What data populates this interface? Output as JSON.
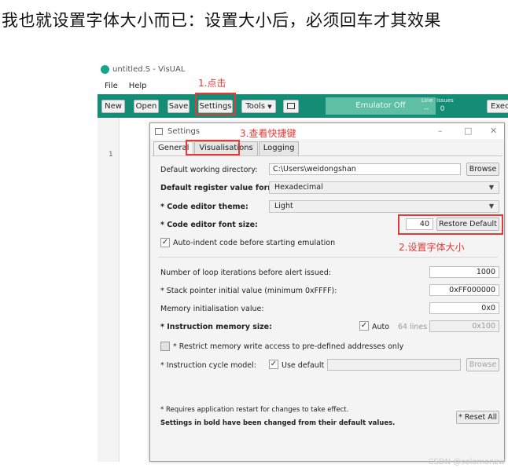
{
  "caption": "我也就设置字体大小而已：设置大小后，必须回车才其效果",
  "app": {
    "title": "untitled.S - VisUAL",
    "menu": [
      "File",
      "Help"
    ],
    "toolbar": {
      "new": "New",
      "open": "Open",
      "save": "Save",
      "settings": "Settings",
      "tools": "Tools",
      "emulator": "Emulator Off",
      "line_label": "Line",
      "issues_label": "Issues",
      "line_value": "--",
      "issues_value": "0",
      "execute": "Exec"
    },
    "editor": {
      "line_number": "1"
    },
    "accent_color": "#138d75"
  },
  "dialog": {
    "title": "Settings",
    "window_controls": {
      "minimize": "–",
      "maximize": "□",
      "close": "✕"
    },
    "tabs": [
      "General",
      "Visualisations",
      "Logging"
    ],
    "active_tab": "General",
    "working_dir": {
      "label": "Default working directory:",
      "value": "C:\\Users\\weidongshan",
      "button": "Browse"
    },
    "register_format": {
      "label": "Default register value format:",
      "value": "Hexadecimal"
    },
    "theme": {
      "label": "* Code editor theme:",
      "value": "Light"
    },
    "font_size": {
      "label": "* Code editor font size:",
      "value": "40",
      "button": "Restore Default"
    },
    "auto_indent": {
      "label": "Auto-indent code before starting emulation",
      "checked": true
    },
    "loop_iterations": {
      "label": "Number of loop iterations before alert issued:",
      "value": "1000"
    },
    "stack_pointer": {
      "label": "* Stack pointer initial value (minimum 0xFFFF):",
      "value": "0xFF000000"
    },
    "memory_init": {
      "label": "Memory initialisation value:",
      "value": "0x0"
    },
    "instruction_memory": {
      "label": "* Instruction memory size:",
      "auto_label": "Auto",
      "lines": "64 lines",
      "value": "0x100"
    },
    "restrict_memory": {
      "label": "* Restrict memory write access to pre-defined addresses only",
      "checked": false
    },
    "cycle_model": {
      "label": "* Instruction cycle model:",
      "default_label": "Use default",
      "button": "Browse"
    },
    "footnote_restart": "* Requires application restart for changes to take effect.",
    "footnote_bold": "Settings in bold have been changed from their default values.",
    "reset_all": "* Reset All"
  },
  "annotations": {
    "step1": "1.点击",
    "step2": "2.设置字体大小",
    "step3": "3.查看快捷键",
    "color": "#e53935"
  },
  "watermark": "CSDN @solomonzw"
}
